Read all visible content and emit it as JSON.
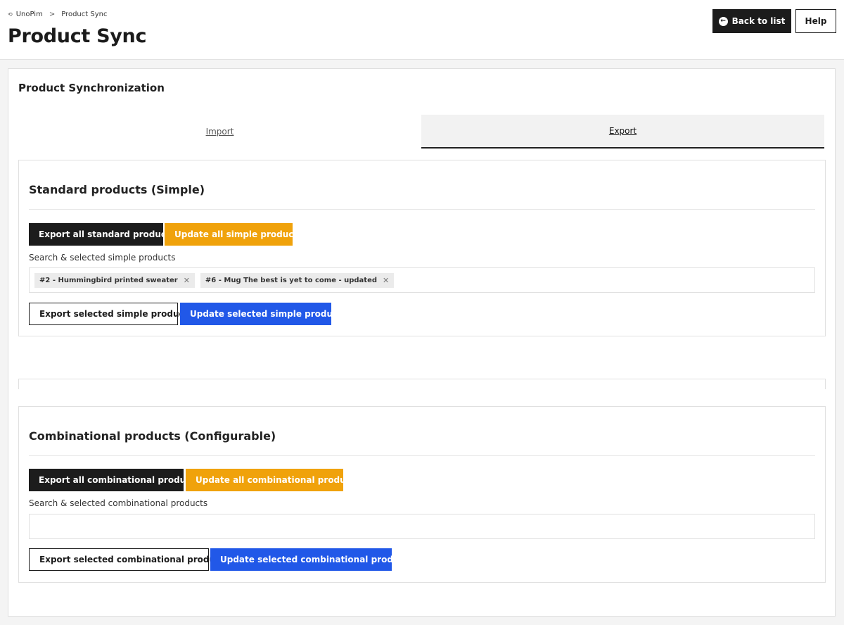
{
  "breadcrumb": {
    "home": "UnoPim",
    "separator": ">",
    "current": "Product Sync"
  },
  "page": {
    "title": "Product Sync"
  },
  "header_actions": {
    "back_label": "Back to list",
    "help_label": "Help"
  },
  "card": {
    "title": "Product Synchronization"
  },
  "tabs": [
    {
      "label": "Import",
      "active": false
    },
    {
      "label": "Export",
      "active": true
    }
  ],
  "simple": {
    "title": "Standard products (Simple)",
    "export_all_label": "Export all standard products",
    "update_all_label": "Update all simple products",
    "search_label": "Search & selected simple products",
    "selected": [
      {
        "label": "#2 - Hummingbird printed sweater"
      },
      {
        "label": "#6 - Mug The best is yet to come - updated"
      }
    ],
    "export_selected_label": "Export selected simple products",
    "update_selected_label": "Update selected simple products"
  },
  "config": {
    "title": "Combinational products (Configurable)",
    "export_all_label": "Export all combinational products",
    "update_all_label": "Update all combinational products",
    "search_label": "Search & selected combinational products",
    "export_selected_label": "Export selected combinational products",
    "update_selected_label": "Update selected combinational products"
  },
  "colors": {
    "dark": "#1c1c1c",
    "orange": "#f0a20b",
    "blue": "#2158e8"
  },
  "icons": {
    "back": "arrow-left-circle-icon",
    "home": "unopim-logo-icon",
    "chip_remove": "close-icon"
  }
}
